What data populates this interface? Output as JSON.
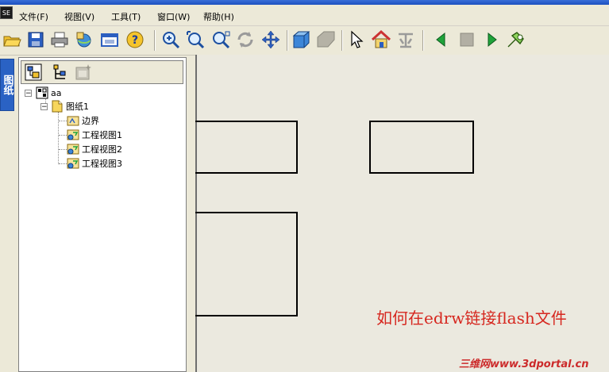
{
  "menu": {
    "logo": "SE",
    "items": [
      "文件(F)",
      "视图(V)",
      "工具(T)",
      "窗口(W)",
      "帮助(H)"
    ]
  },
  "toolbar": {
    "icons": [
      "open-icon",
      "save-icon",
      "print-icon",
      "publish-icon",
      "options-icon",
      "help-icon",
      "zoom-area-icon",
      "zoom-in-icon",
      "zoom-fit-icon",
      "rotate-icon",
      "pan-icon",
      "3d-view-icon",
      "shaded-icon",
      "select-icon",
      "home-view-icon",
      "measure-icon",
      "prev-icon",
      "stop-icon",
      "play-icon",
      "markup-icon"
    ]
  },
  "side_tab": {
    "label": "图纸"
  },
  "tree": {
    "root": "aa",
    "sheet": "图纸1",
    "children": [
      "边界",
      "工程视图1",
      "工程视图2",
      "工程视图3"
    ]
  },
  "canvas": {
    "caption": "如何在edrw链接flash文件",
    "watermark": "三维网www.3dportal.cn"
  },
  "colors": {
    "caption": "#d6271f",
    "accent": "#2a62c4",
    "canvas": "#ebe9df"
  }
}
